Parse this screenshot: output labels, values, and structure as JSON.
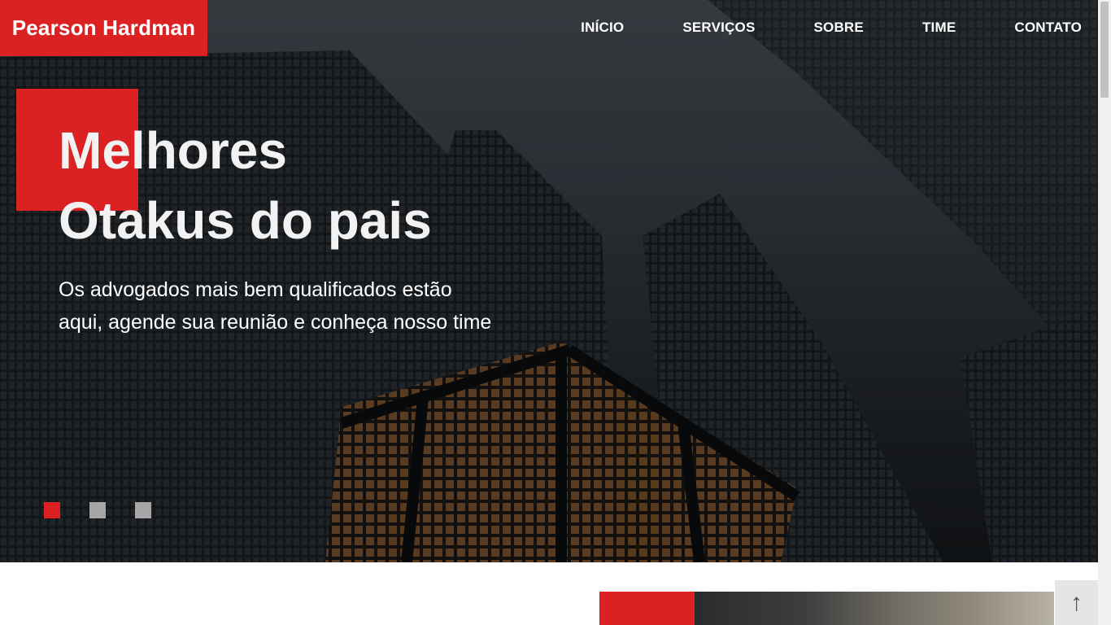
{
  "header": {
    "brand": "Pearson Hardman",
    "nav": [
      "INÍCIO",
      "SERVIÇOS",
      "SOBRE",
      "TIME",
      "CONTATO"
    ]
  },
  "hero": {
    "title_line1": "Melhores",
    "title_line2": "Otakus do pais",
    "subtitle": "Os advogados mais bem qualificados estão aqui, agende sua reunião e conheça nosso time",
    "slides": {
      "count": 3,
      "active": 1
    }
  },
  "back_to_top": {
    "icon": "arrow-up-icon",
    "glyph": "↑"
  },
  "colors": {
    "accent": "#dc2123",
    "dot_inactive": "#a6a6a6",
    "text": "#ffffff"
  }
}
